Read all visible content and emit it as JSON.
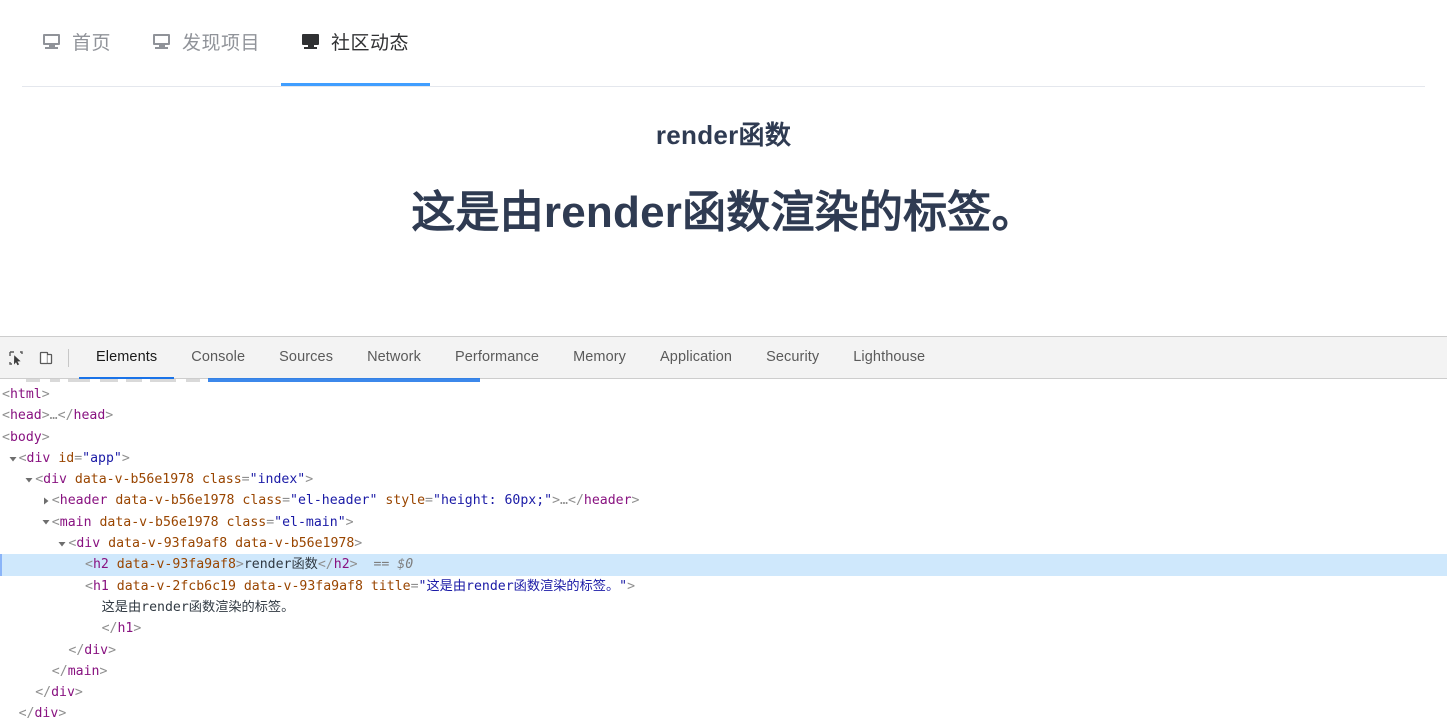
{
  "page": {
    "nav": {
      "items": [
        {
          "icon": "monitor-icon",
          "label": "首页",
          "active": false
        },
        {
          "icon": "monitor-icon",
          "label": "发现项目",
          "active": false
        },
        {
          "icon": "monitor-icon",
          "label": "社区动态",
          "active": true
        }
      ]
    },
    "main": {
      "heading_h2": "render函数",
      "heading_h1": "这是由render函数渲染的标签。"
    },
    "colors": {
      "accent": "#409EFF",
      "text_active": "#303133",
      "text_inactive": "#909399",
      "heading": "#2f3b52"
    }
  },
  "devtools": {
    "toolbar": {
      "inspect_tooltip": "Select an element in the page to inspect it",
      "device_tooltip": "Toggle device toolbar",
      "tabs": [
        {
          "label": "Elements",
          "active": true
        },
        {
          "label": "Console",
          "active": false
        },
        {
          "label": "Sources",
          "active": false
        },
        {
          "label": "Network",
          "active": false
        },
        {
          "label": "Performance",
          "active": false
        },
        {
          "label": "Memory",
          "active": false
        },
        {
          "label": "Application",
          "active": false
        },
        {
          "label": "Security",
          "active": false
        },
        {
          "label": "Lighthouse",
          "active": false
        }
      ],
      "accent": "#1a73e8"
    },
    "tree": {
      "selected_row_index": 8,
      "selection_ref": "== $0",
      "rows": [
        {
          "indent": 0,
          "twisty": "none",
          "segments": [
            {
              "t": "punct",
              "v": "<"
            },
            {
              "t": "tag",
              "v": "html"
            },
            {
              "t": "punct",
              "v": ">"
            }
          ]
        },
        {
          "indent": 0,
          "twisty": "collapsed",
          "segments": [
            {
              "t": "punct",
              "v": "<"
            },
            {
              "t": "tag",
              "v": "head"
            },
            {
              "t": "punct",
              "v": ">"
            },
            {
              "t": "ghost",
              "v": "…"
            },
            {
              "t": "punct",
              "v": "</"
            },
            {
              "t": "tag",
              "v": "head"
            },
            {
              "t": "punct",
              "v": ">"
            }
          ]
        },
        {
          "indent": 0,
          "twisty": "expanded",
          "segments": [
            {
              "t": "punct",
              "v": "<"
            },
            {
              "t": "tag",
              "v": "body"
            },
            {
              "t": "punct",
              "v": ">"
            }
          ]
        },
        {
          "indent": 1,
          "twisty": "expanded",
          "segments": [
            {
              "t": "punct",
              "v": "<"
            },
            {
              "t": "tag",
              "v": "div"
            },
            {
              "t": "punct",
              "v": " "
            },
            {
              "t": "attr",
              "v": "id"
            },
            {
              "t": "punct",
              "v": "="
            },
            {
              "t": "val",
              "v": "\"app\""
            },
            {
              "t": "punct",
              "v": ">"
            }
          ]
        },
        {
          "indent": 2,
          "twisty": "expanded",
          "segments": [
            {
              "t": "punct",
              "v": "<"
            },
            {
              "t": "tag",
              "v": "div"
            },
            {
              "t": "punct",
              "v": " "
            },
            {
              "t": "attr",
              "v": "data-v-b56e1978"
            },
            {
              "t": "punct",
              "v": " "
            },
            {
              "t": "attr",
              "v": "class"
            },
            {
              "t": "punct",
              "v": "="
            },
            {
              "t": "val",
              "v": "\"index\""
            },
            {
              "t": "punct",
              "v": ">"
            }
          ]
        },
        {
          "indent": 3,
          "twisty": "collapsed",
          "segments": [
            {
              "t": "punct",
              "v": "<"
            },
            {
              "t": "tag",
              "v": "header"
            },
            {
              "t": "punct",
              "v": " "
            },
            {
              "t": "attr",
              "v": "data-v-b56e1978"
            },
            {
              "t": "punct",
              "v": " "
            },
            {
              "t": "attr",
              "v": "class"
            },
            {
              "t": "punct",
              "v": "="
            },
            {
              "t": "val",
              "v": "\"el-header\""
            },
            {
              "t": "punct",
              "v": " "
            },
            {
              "t": "attr",
              "v": "style"
            },
            {
              "t": "punct",
              "v": "="
            },
            {
              "t": "val",
              "v": "\"height: 60px;\""
            },
            {
              "t": "punct",
              "v": ">"
            },
            {
              "t": "ghost",
              "v": "…"
            },
            {
              "t": "punct",
              "v": "</"
            },
            {
              "t": "tag",
              "v": "header"
            },
            {
              "t": "punct",
              "v": ">"
            }
          ]
        },
        {
          "indent": 3,
          "twisty": "expanded",
          "segments": [
            {
              "t": "punct",
              "v": "<"
            },
            {
              "t": "tag",
              "v": "main"
            },
            {
              "t": "punct",
              "v": " "
            },
            {
              "t": "attr",
              "v": "data-v-b56e1978"
            },
            {
              "t": "punct",
              "v": " "
            },
            {
              "t": "attr",
              "v": "class"
            },
            {
              "t": "punct",
              "v": "="
            },
            {
              "t": "val",
              "v": "\"el-main\""
            },
            {
              "t": "punct",
              "v": ">"
            }
          ]
        },
        {
          "indent": 4,
          "twisty": "expanded",
          "segments": [
            {
              "t": "punct",
              "v": "<"
            },
            {
              "t": "tag",
              "v": "div"
            },
            {
              "t": "punct",
              "v": " "
            },
            {
              "t": "attr",
              "v": "data-v-93fa9af8"
            },
            {
              "t": "punct",
              "v": " "
            },
            {
              "t": "attr",
              "v": "data-v-b56e1978"
            },
            {
              "t": "punct",
              "v": ">"
            }
          ]
        },
        {
          "indent": 5,
          "twisty": "none",
          "selected": true,
          "segments": [
            {
              "t": "punct",
              "v": "<"
            },
            {
              "t": "tag",
              "v": "h2"
            },
            {
              "t": "punct",
              "v": " "
            },
            {
              "t": "attr",
              "v": "data-v-93fa9af8"
            },
            {
              "t": "punct",
              "v": ">"
            },
            {
              "t": "text",
              "v": "render函数"
            },
            {
              "t": "punct",
              "v": "</"
            },
            {
              "t": "tag",
              "v": "h2"
            },
            {
              "t": "punct",
              "v": ">"
            },
            {
              "t": "ref",
              "v": "  == $0"
            }
          ]
        },
        {
          "indent": 5,
          "twisty": "none",
          "segments": [
            {
              "t": "punct",
              "v": "<"
            },
            {
              "t": "tag",
              "v": "h1"
            },
            {
              "t": "punct",
              "v": " "
            },
            {
              "t": "attr",
              "v": "data-v-2fcb6c19"
            },
            {
              "t": "punct",
              "v": " "
            },
            {
              "t": "attr",
              "v": "data-v-93fa9af8"
            },
            {
              "t": "punct",
              "v": " "
            },
            {
              "t": "attr",
              "v": "title"
            },
            {
              "t": "punct",
              "v": "="
            },
            {
              "t": "val",
              "v": "\"这是由render函数渲染的标签。\""
            },
            {
              "t": "punct",
              "v": ">"
            }
          ]
        },
        {
          "indent": 6,
          "twisty": "none",
          "segments": [
            {
              "t": "text",
              "v": "这是由render函数渲染的标签。"
            }
          ]
        },
        {
          "indent": 6,
          "twisty": "none",
          "segments": [
            {
              "t": "punct",
              "v": "</"
            },
            {
              "t": "tag",
              "v": "h1"
            },
            {
              "t": "punct",
              "v": ">"
            }
          ]
        },
        {
          "indent": 4,
          "twisty": "none",
          "segments": [
            {
              "t": "punct",
              "v": "</"
            },
            {
              "t": "tag",
              "v": "div"
            },
            {
              "t": "punct",
              "v": ">"
            }
          ]
        },
        {
          "indent": 3,
          "twisty": "none",
          "segments": [
            {
              "t": "punct",
              "v": "</"
            },
            {
              "t": "tag",
              "v": "main"
            },
            {
              "t": "punct",
              "v": ">"
            }
          ]
        },
        {
          "indent": 2,
          "twisty": "none",
          "segments": [
            {
              "t": "punct",
              "v": "</"
            },
            {
              "t": "tag",
              "v": "div"
            },
            {
              "t": "punct",
              "v": ">"
            }
          ]
        },
        {
          "indent": 1,
          "twisty": "none",
          "segments": [
            {
              "t": "punct",
              "v": "</"
            },
            {
              "t": "tag",
              "v": "div"
            },
            {
              "t": "punct",
              "v": ">"
            }
          ]
        }
      ]
    }
  }
}
